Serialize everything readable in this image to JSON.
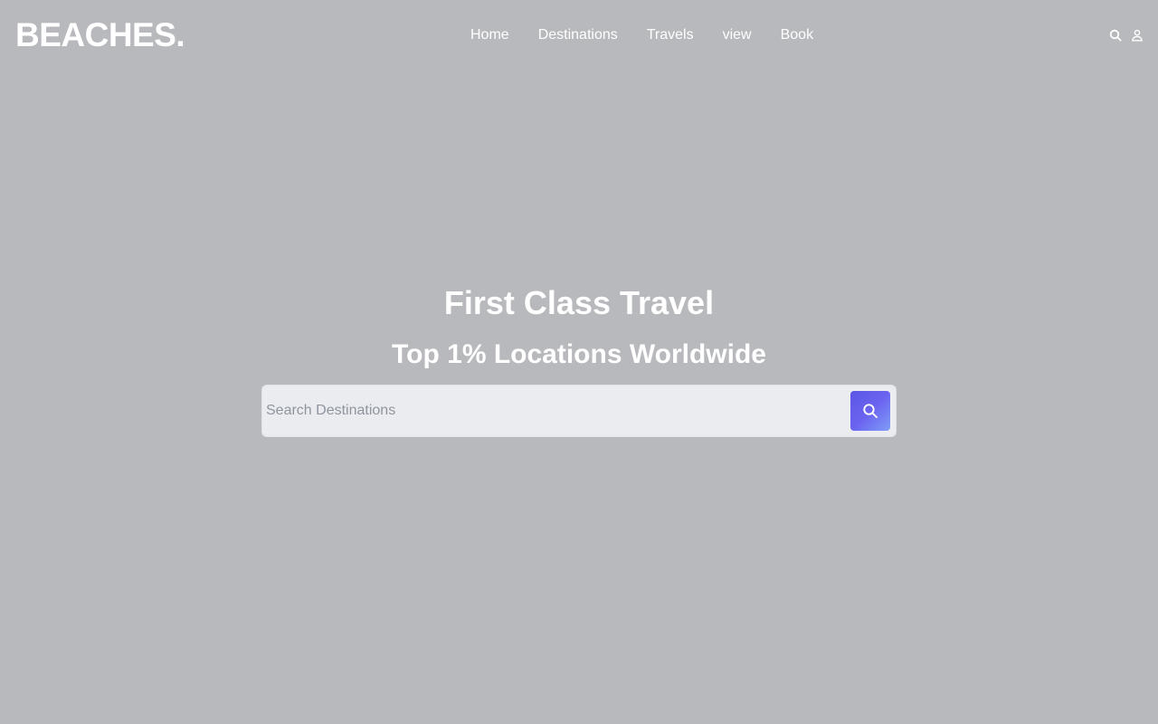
{
  "header": {
    "logo": "BEACHES.",
    "nav": [
      "Home",
      "Destinations",
      "Travels",
      "view",
      "Book"
    ],
    "icons": [
      "search-icon",
      "user-icon"
    ]
  },
  "hero": {
    "title": "First Class Travel",
    "subtitle": "Top 1% Locations Worldwide"
  },
  "search": {
    "placeholder": "Search Destinations",
    "value": "",
    "button_icon": "search-icon"
  },
  "colors": {
    "background": "#b8b9bd",
    "text": "#ffffff",
    "search_field": "#ebecef",
    "button_gradient_start": "#5b57e4",
    "button_gradient_end": "#7f9df7"
  }
}
